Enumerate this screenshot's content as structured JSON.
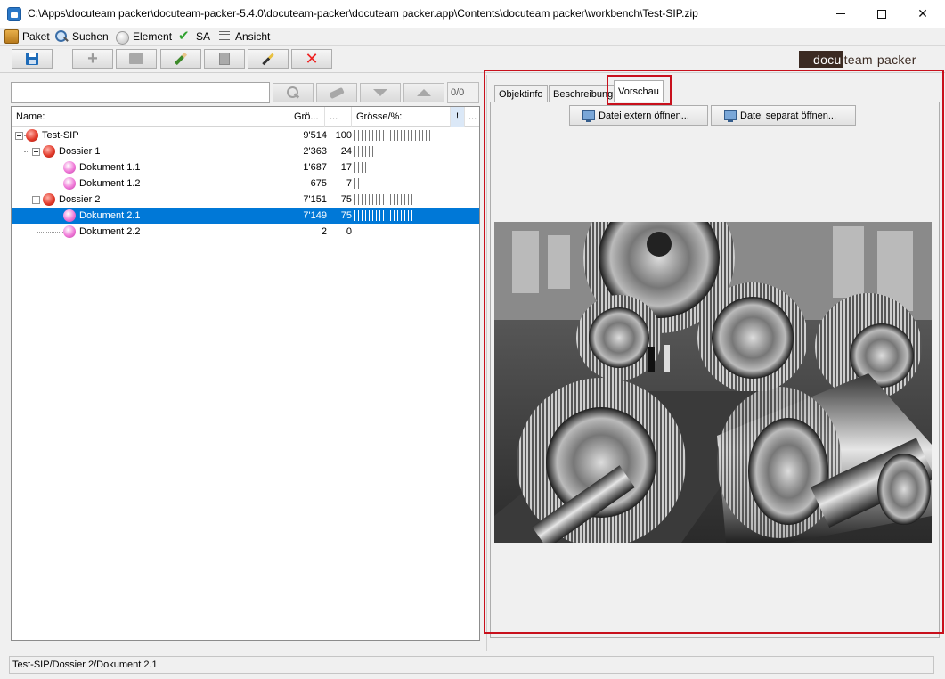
{
  "window": {
    "title": "C:\\Apps\\docuteam packer\\docuteam-packer-5.4.0\\docuteam-packer\\docuteam packer.app\\Contents\\docuteam packer\\workbench\\Test-SIP.zip",
    "close_glyph": "✕"
  },
  "menu": {
    "items": [
      {
        "label": "Paket",
        "icon": "package-icon"
      },
      {
        "label": "Suchen",
        "icon": "search-icon"
      },
      {
        "label": "Element",
        "icon": "element-icon"
      },
      {
        "label": "SA",
        "icon": "checkmark-icon"
      },
      {
        "label": "Ansicht",
        "icon": "view-icon"
      }
    ]
  },
  "toolbar": {
    "buttons": [
      "save-icon",
      "add-icon",
      "folder-icon",
      "edit-pencil-icon",
      "copy-icon",
      "wand-icon",
      "delete-icon"
    ],
    "delete_glyph": "✕",
    "add_glyph": "+"
  },
  "logo": {
    "part1": "docu",
    "part2": "team",
    "part3": "packer"
  },
  "search": {
    "placeholder": "",
    "value": "",
    "count": "0/0"
  },
  "tree": {
    "columns": {
      "name": "Name:",
      "size": "Grö...",
      "dots": "...",
      "percent": "Grösse/%:",
      "flag": "!",
      "more": "..."
    },
    "rows": [
      {
        "name": "Test-SIP",
        "size": "9'514",
        "percent": "100",
        "bar_percent": 100,
        "level": 0,
        "type": "folder"
      },
      {
        "name": "Dossier 1",
        "size": "2'363",
        "percent": "24",
        "bar_percent": 24,
        "level": 1,
        "type": "folder"
      },
      {
        "name": "Dokument 1.1",
        "size": "1'687",
        "percent": "17",
        "bar_percent": 17,
        "level": 2,
        "type": "file"
      },
      {
        "name": "Dokument 1.2",
        "size": "675",
        "percent": "7",
        "bar_percent": 7,
        "level": 2,
        "type": "file"
      },
      {
        "name": "Dossier 2",
        "size": "7'151",
        "percent": "75",
        "bar_percent": 75,
        "level": 1,
        "type": "folder"
      },
      {
        "name": "Dokument 2.1",
        "size": "7'149",
        "percent": "75",
        "bar_percent": 75,
        "level": 2,
        "type": "file",
        "selected": true
      },
      {
        "name": "Dokument 2.2",
        "size": "2",
        "percent": "0",
        "bar_percent": 0,
        "level": 2,
        "type": "file"
      }
    ]
  },
  "tabs": {
    "objektinfo": "Objektinfo",
    "beschreibung": "Beschreibung",
    "vorschau": "Vorschau",
    "active": "Vorschau"
  },
  "preview": {
    "btn_extern": "Datei extern öffnen...",
    "btn_separat": "Datei separat öffnen...",
    "image_icon": "preview-photo"
  },
  "status": {
    "path": "Test-SIP/Dossier 2/Dokument 2.1"
  },
  "colors": {
    "selection": "#0078d7",
    "highlight_frame": "#c8101c",
    "logo_dark": "#3b2a22"
  }
}
